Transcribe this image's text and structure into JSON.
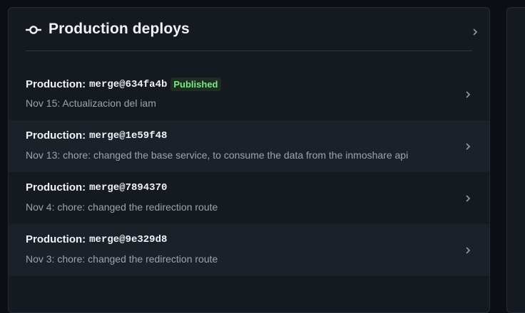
{
  "panel": {
    "title": "Production deploys",
    "title_icon": "git-commit-icon"
  },
  "deploys": [
    {
      "label": "Production:",
      "ref": "merge@634fa4b",
      "badge": "Published",
      "description": "Nov 15: Actualizacion del iam"
    },
    {
      "label": "Production:",
      "ref": "merge@1e59f48",
      "badge": "",
      "description": "Nov 13: chore: changed the base service, to consume the data from the inmoshare api"
    },
    {
      "label": "Production:",
      "ref": "merge@7894370",
      "badge": "",
      "description": "Nov 4: chore: changed the redirection route"
    },
    {
      "label": "Production:",
      "ref": "merge@9e329d8",
      "badge": "",
      "description": "Nov 3: chore: changed the redirection route"
    }
  ],
  "colors": {
    "background": "#0b0e13",
    "card": "#151a21",
    "row_alt": "#1b2129",
    "badge_bg": "#1c2d22",
    "badge_text": "#7ee787",
    "muted_text": "#9ba4ae"
  }
}
